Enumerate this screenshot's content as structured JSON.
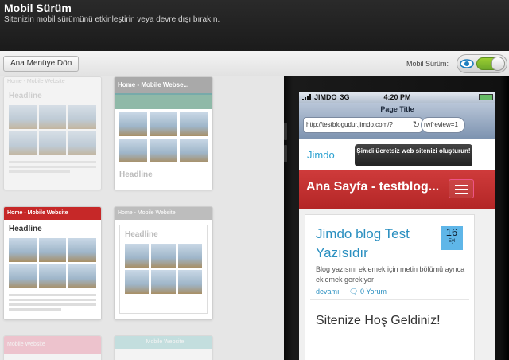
{
  "header": {
    "title": "Mobil Sürüm",
    "subtitle": "Sitenizin mobil sürümünü etkinleştirin veya devre dışı bırakın."
  },
  "toolbar": {
    "back_label": "Ana Menüye Dön",
    "mobile_label": "Mobil Sürüm:",
    "toggle_on": true
  },
  "templates": {
    "items": [
      {
        "bar": "Home - Mobile Website",
        "headline": "Headline",
        "bar_color": "#ffffff",
        "bar_text": "#bbbbbb"
      },
      {
        "bar": "Home - Mobile Webse...",
        "headline": "Headline",
        "bar_color": "#a9a9a9",
        "bar_text": "#ffffff"
      },
      {
        "bar": "Home - Mobile Website",
        "headline": "Headline",
        "bar_color": "#c62828",
        "bar_text": "#ffffff"
      },
      {
        "bar": "Home - Mobile Website",
        "headline": "Headline",
        "bar_color": "#bdbdbd",
        "bar_text": "#ffffff"
      },
      {
        "bar": "Mobile Website",
        "headline": "",
        "bar_color": "#f4a7b9",
        "bar_text": "#ffffff"
      },
      {
        "bar": "Mobile Website",
        "headline": "",
        "bar_color": "#a7d8d8",
        "bar_text": "#ffffff"
      }
    ]
  },
  "phone": {
    "carrier": "JIMDO",
    "network": "3G",
    "time": "4:20 PM",
    "page_title": "Page Title",
    "url": "http://testblogudur.jimdo.com/?",
    "search_value": "rwfreview=1",
    "logo": "Jimdo",
    "promo": "Şimdi ücretsiz web sitenizi oluşturun!",
    "site_title": "Ana Sayfa - testblog...",
    "post": {
      "title": "Jimdo blog Test Yazısıdır",
      "day": "16",
      "month": "Eyl",
      "excerpt": "Blog yazısını eklemek için metin bölümü ayrıca eklemek gerekiyor",
      "more": "devamı",
      "comments": "0 Yorum"
    },
    "welcome": "Sitenize Hoş Geldiniz!"
  },
  "colors": {
    "accent_blue": "#2a8fc0",
    "site_red": "#c62828",
    "toggle_green": "#7cbf2b"
  }
}
